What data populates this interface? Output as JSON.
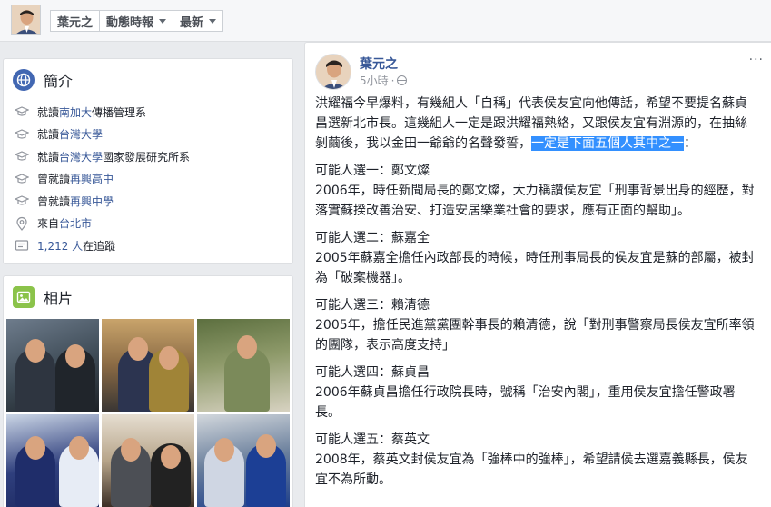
{
  "topbar": {
    "crumbs": [
      "葉元之",
      "動態時報",
      "最新"
    ]
  },
  "intro": {
    "title": "簡介",
    "items": [
      {
        "icon": "graduation-cap-icon",
        "prefix": "就讀",
        "link": "南加大",
        "suffix": "傳播管理系"
      },
      {
        "icon": "graduation-cap-icon",
        "prefix": "就讀",
        "link": "台灣大學",
        "suffix": ""
      },
      {
        "icon": "graduation-cap-icon",
        "prefix": "就讀",
        "link": "台灣大學",
        "suffix": "國家發展研究所系"
      },
      {
        "icon": "graduation-cap-icon",
        "prefix": "曾就讀",
        "link": "再興高中",
        "suffix": ""
      },
      {
        "icon": "graduation-cap-icon",
        "prefix": "曾就讀",
        "link": "再興中學",
        "suffix": ""
      },
      {
        "icon": "location-pin-icon",
        "prefix": "來自",
        "link": "台北市",
        "suffix": ""
      },
      {
        "icon": "followers-icon",
        "prefix": "",
        "link": "1,212 人",
        "suffix": "在追蹤"
      }
    ]
  },
  "photos": {
    "title": "相片"
  },
  "post": {
    "author": "葉元之",
    "time": "5小時",
    "more": "···",
    "intro_text": "洪耀福今早爆料，有幾組人「自稱」代表侯友宜向他傳話，希望不要提名蘇貞昌選新北市長。這幾組人一定是跟洪耀福熟絡，又跟侯友宜有淵源的，在抽絲剝繭後，我以金田一爺爺的名聲發誓，",
    "highlight_text": "一定是下面五個人其中之一",
    "tail_text": "：",
    "candidates": [
      {
        "head": "可能人選一：鄭文燦",
        "text": "2006年，時任新聞局長的鄭文燦，大力稱讚侯友宜「刑事背景出身的經歷，對落實蘇揆改善治安、打造安居樂業社會的要求，應有正面的幫助」。"
      },
      {
        "head": "可能人選二：蘇嘉全",
        "text": "2005年蘇嘉全擔任內政部長的時候，時任刑事局長的侯友宜是蘇的部屬，被封為「破案機器」。"
      },
      {
        "head": "可能人選三：賴清德",
        "text": "2005年，擔任民進黨黨團幹事長的賴清德，說「對刑事警察局長侯友宜所率領的團隊，表示高度支持」"
      },
      {
        "head": "可能人選四：蘇貞昌",
        "text": "2006年蘇貞昌擔任行政院長時，號稱「治安內閣」，重用侯友宜擔任警政署長。"
      },
      {
        "head": "可能人選五：蔡英文",
        "text": "2008年，蔡英文封侯友宜為「強棒中的強棒」，希望請侯去選嘉義縣長，侯友宜不為所動。"
      }
    ]
  }
}
